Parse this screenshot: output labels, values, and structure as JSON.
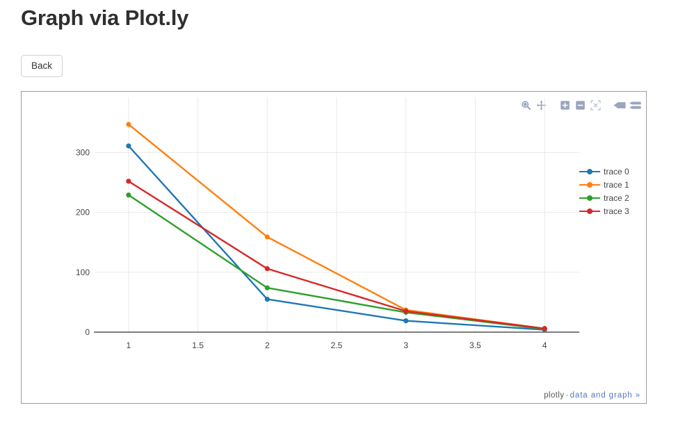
{
  "header": {
    "title": "Graph via Plot.ly"
  },
  "toolbar": {
    "back_label": "Back"
  },
  "modebar": {
    "buttons": [
      {
        "name": "zoom-icon",
        "title": "Zoom"
      },
      {
        "name": "pan-icon",
        "title": "Pan"
      },
      {
        "name": "zoom-in-icon",
        "title": "Zoom in"
      },
      {
        "name": "zoom-out-icon",
        "title": "Zoom out"
      },
      {
        "name": "autoscale-icon",
        "title": "Autoscale"
      },
      {
        "name": "hover-closest-icon",
        "title": "Show closest data on hover"
      },
      {
        "name": "hover-compare-icon",
        "title": "Compare data on hover"
      }
    ]
  },
  "footer": {
    "brand": "plotly",
    "separator": "-",
    "link": "data and graph »"
  },
  "chart_data": {
    "type": "line",
    "title": "",
    "xlabel": "",
    "ylabel": "",
    "x": [
      1,
      2,
      3,
      4
    ],
    "xlim": [
      0.82,
      4.18
    ],
    "ylim": [
      -14,
      376
    ],
    "xticks": [
      "1",
      "1.5",
      "2",
      "2.5",
      "3",
      "3.5",
      "4"
    ],
    "xtickvals": [
      1,
      1.5,
      2,
      2.5,
      3,
      3.5,
      4
    ],
    "yticks": [
      "0",
      "100",
      "200",
      "300"
    ],
    "ytickvals": [
      0,
      100,
      200,
      300
    ],
    "grid": true,
    "legend_position": "right",
    "series": [
      {
        "name": "trace 0",
        "color": "#1f77b4",
        "values": [
          311,
          55,
          19,
          4
        ]
      },
      {
        "name": "trace 1",
        "color": "#ff7f0e",
        "values": [
          347,
          159,
          37,
          6
        ]
      },
      {
        "name": "trace 2",
        "color": "#2ca02c",
        "values": [
          229,
          74,
          33,
          5
        ]
      },
      {
        "name": "trace 3",
        "color": "#d62728",
        "values": [
          252,
          106,
          35,
          6
        ]
      }
    ]
  }
}
